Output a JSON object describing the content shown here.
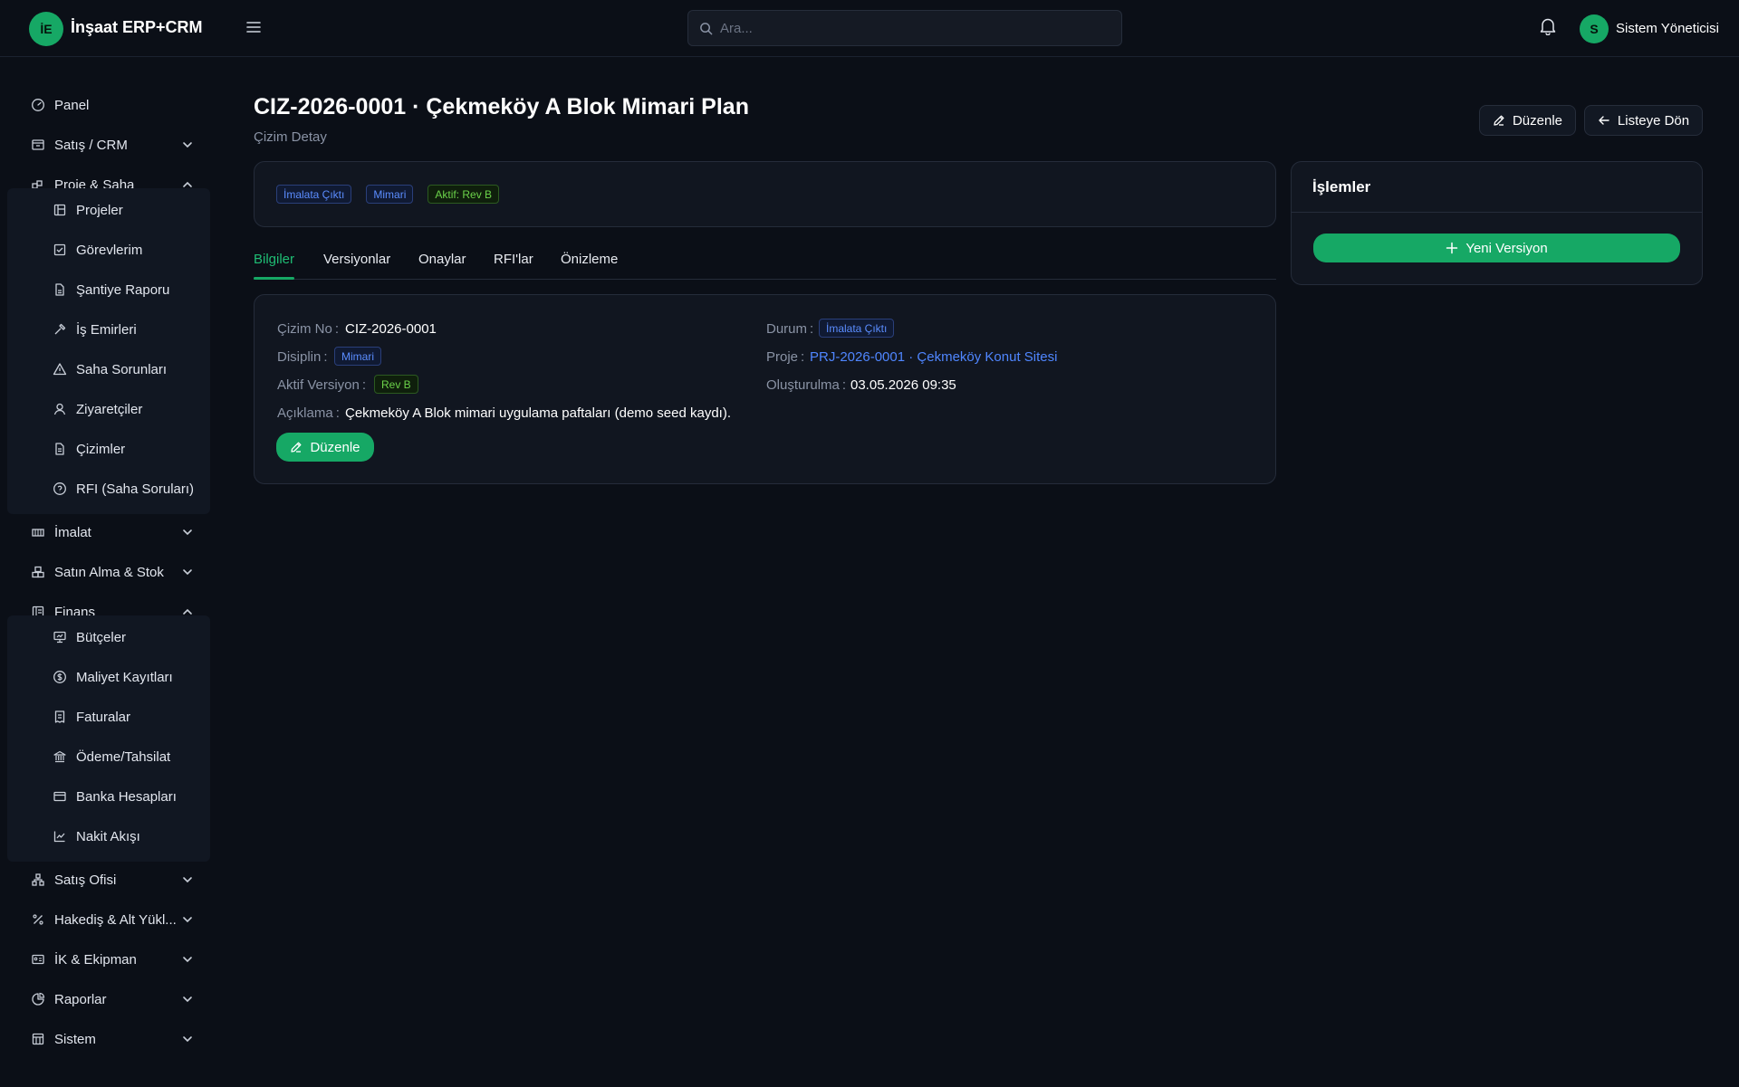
{
  "app": {
    "logo_initials": "İE",
    "title": "İnşaat ERP+CRM"
  },
  "header": {
    "search_placeholder": "Ara...",
    "user_initial": "S",
    "user_name": "Sistem Yöneticisi"
  },
  "sidebar": {
    "panel": "Panel",
    "satis_crm": "Satış / CRM",
    "proje_saha": "Proje & Saha",
    "proje_items": [
      "Projeler",
      "Görevlerim",
      "Şantiye Raporu",
      "İş Emirleri",
      "Saha Sorunları",
      "Ziyaretçiler",
      "Çizimler",
      "RFI (Saha Soruları)"
    ],
    "imalat": "İmalat",
    "satin_alma": "Satın Alma & Stok",
    "finans": "Finans",
    "finans_items": [
      "Bütçeler",
      "Maliyet Kayıtları",
      "Faturalar",
      "Ödeme/Tahsilat",
      "Banka Hesapları",
      "Nakit Akışı"
    ],
    "satis_ofisi": "Satış Ofisi",
    "hakedis": "Hakediş & Alt Yükl...",
    "ik": "İK & Ekipman",
    "raporlar": "Raporlar",
    "sistem": "Sistem"
  },
  "page": {
    "title": "CIZ-2026-0001 · Çekmeköy A Blok Mimari Plan",
    "subtitle": "Çizim Detay",
    "edit_label": "Düzenle",
    "back_label": "Listeye Dön"
  },
  "badges": {
    "status": "İmalata Çıktı",
    "discipline": "Mimari",
    "active": "Aktif: Rev B"
  },
  "tabs": [
    "Bilgiler",
    "Versiyonlar",
    "Onaylar",
    "RFI'lar",
    "Önizleme"
  ],
  "details": {
    "drawing_no_label": "Çizim No",
    "drawing_no": "CIZ-2026-0001",
    "discipline_label": "Disiplin",
    "discipline": "Mimari",
    "active_version_label": "Aktif Versiyon",
    "active_version": "Rev B",
    "description_label": "Açıklama",
    "description": "Çekmeköy A Blok mimari uygulama paftaları (demo seed kaydı).",
    "status_label": "Durum",
    "status": "İmalata Çıktı",
    "project_label": "Proje",
    "project": "PRJ-2026-0001 · Çekmeköy Konut Sitesi",
    "created_label": "Oluşturulma",
    "created": "03.05.2026 09:35",
    "colon": ":",
    "edit_button": "Düzenle"
  },
  "actions": {
    "title": "İşlemler",
    "new_version": "Yeni Versiyon"
  }
}
